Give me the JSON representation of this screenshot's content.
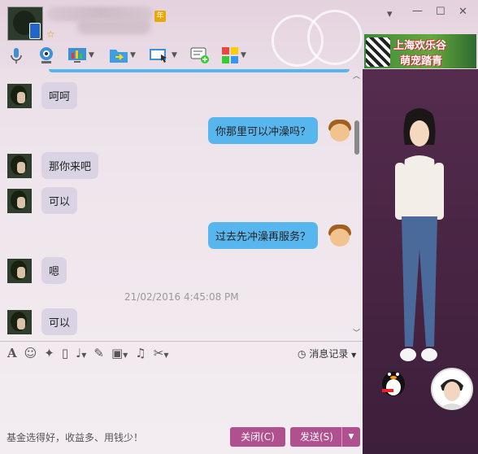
{
  "window": {
    "controls": {
      "menu": "▾",
      "minimize": "—",
      "maximize": "☐",
      "close": "✕"
    },
    "year_badge": "年"
  },
  "toolbar": {
    "icons": [
      "microphone-icon",
      "video-call-icon",
      "screen-share-icon",
      "file-transfer-icon",
      "remote-assist-icon",
      "message-add-icon",
      "apps-icon"
    ]
  },
  "ad": {
    "line1": "上海欢乐谷",
    "line2": "萌宠踏青"
  },
  "messages": [
    {
      "dir": "in",
      "text": "呵呵"
    },
    {
      "dir": "out",
      "text": "你那里可以冲澡吗？"
    },
    {
      "dir": "in",
      "text": "那你来吧"
    },
    {
      "dir": "in",
      "text": "可以"
    },
    {
      "dir": "out",
      "text": "过去先冲澡再服务？"
    },
    {
      "dir": "in",
      "text": "嗯"
    },
    {
      "dir": "in",
      "text": "可以"
    }
  ],
  "timestamp": "21/02/2016 4:45:08 PM",
  "input_toolbar": {
    "icons": [
      "font-icon",
      "emoji-icon",
      "magic-icon",
      "vibrate-icon",
      "voice-icon",
      "edit-icon",
      "image-icon",
      "music-icon",
      "screenshot-icon"
    ],
    "history_label": "消息记录"
  },
  "footer": {
    "tip": "基金选得好，收益多、用钱少！",
    "close_label": "关闭(C)",
    "send_label": "发送(S)"
  },
  "colors": {
    "accent": "#b0508e",
    "bubble_out": "#58b6ee",
    "bubble_in": "#d9d3e3"
  }
}
